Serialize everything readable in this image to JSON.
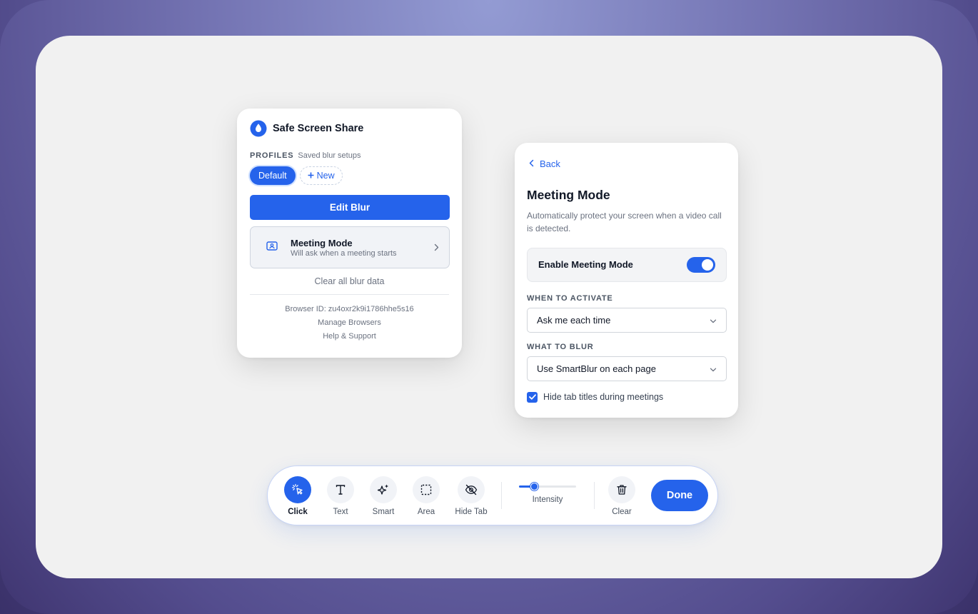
{
  "popup": {
    "app_title": "Safe Screen Share",
    "profiles_label": "PROFILES",
    "profiles_sub": "Saved blur setups",
    "profile_default": "Default",
    "profile_new": "New",
    "edit_blur": "Edit Blur",
    "meeting_title": "Meeting Mode",
    "meeting_sub": "Will ask when a meeting starts",
    "clear_data": "Clear all blur data",
    "browser_id": "Browser ID: zu4oxr2k9i1786hhe5s16",
    "manage_browsers": "Manage Browsers",
    "help_support": "Help & Support"
  },
  "panel": {
    "back": "Back",
    "title": "Meeting Mode",
    "description": "Automatically protect your screen when a video call is detected.",
    "toggle_label": "Enable Meeting Mode",
    "toggle_on": true,
    "when_label": "WHEN TO ACTIVATE",
    "when_value": "Ask me each time",
    "what_label": "WHAT TO BLUR",
    "what_value": "Use SmartBlur on each page",
    "checkbox_label": "Hide tab titles during meetings",
    "checkbox_checked": true
  },
  "toolbar": {
    "tools": [
      {
        "label": "Click",
        "icon": "cursor-click-icon",
        "active": true
      },
      {
        "label": "Text",
        "icon": "text-icon",
        "active": false
      },
      {
        "label": "Smart",
        "icon": "sparkles-icon",
        "active": false
      },
      {
        "label": "Area",
        "icon": "dashed-square-icon",
        "active": false
      },
      {
        "label": "Hide Tab",
        "icon": "eye-off-icon",
        "active": false
      }
    ],
    "intensity_label": "Intensity",
    "intensity_value": 0.27,
    "clear_label": "Clear",
    "done_label": "Done"
  },
  "colors": {
    "accent": "#2563eb",
    "screen_bg": "#f1f1f1",
    "frame": "#6f6fae"
  }
}
